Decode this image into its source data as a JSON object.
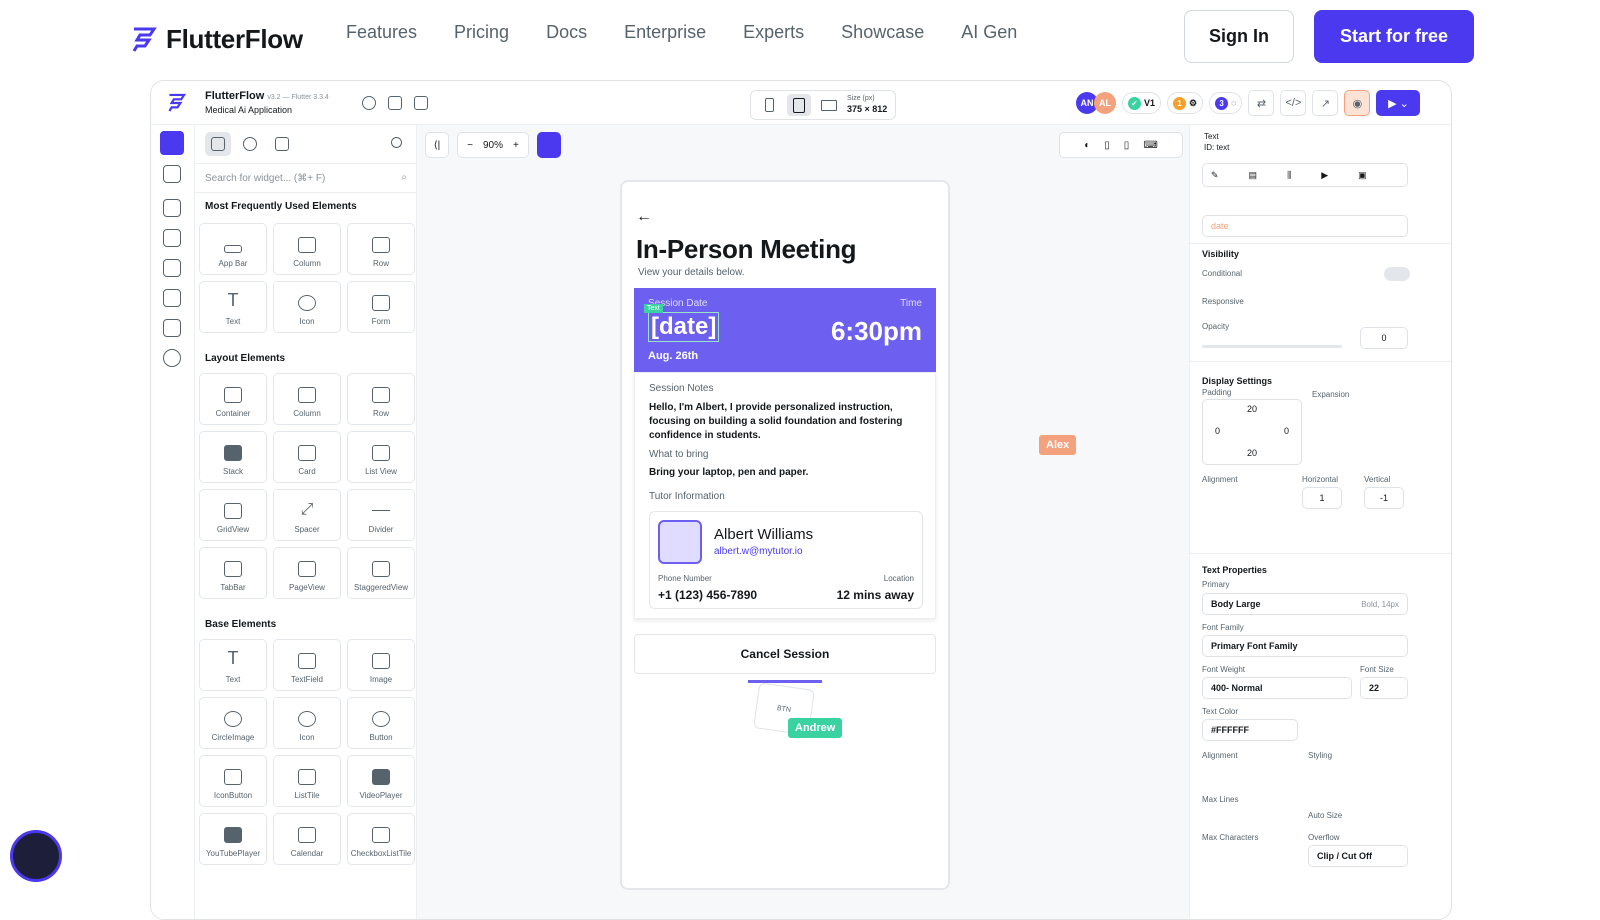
{
  "site": {
    "brand": "FlutterFlow",
    "nav": [
      "Features",
      "Pricing",
      "Docs",
      "Enterprise",
      "Experts",
      "Showcase",
      "AI Gen"
    ],
    "sign_in": "Sign In",
    "start": "Start for free"
  },
  "editor": {
    "project_name": "FlutterFlow",
    "version": "v3.2 — Flutter 3.3.4",
    "app_name": "Medical Ai Application",
    "size_label": "Size (px)",
    "size_value": "375 × 812",
    "avatars": [
      "AN",
      "AL"
    ],
    "version_tag": "V1",
    "count1": "1",
    "count2": "3"
  },
  "widgets": {
    "search_placeholder": "Search for widget... (⌘+ F)",
    "sections": [
      {
        "title": "Most Frequently Used Elements",
        "items": [
          "App Bar",
          "Column",
          "Row",
          "Text",
          "Icon",
          "Form"
        ]
      },
      {
        "title": "Layout Elements",
        "items": [
          "Container",
          "Column",
          "Row",
          "Stack",
          "Card",
          "List View",
          "GridView",
          "Spacer",
          "Divider",
          "TabBar",
          "PageView",
          "StaggeredView"
        ]
      },
      {
        "title": "Base Elements",
        "items": [
          "Text",
          "TextField",
          "Image",
          "CircleImage",
          "Icon",
          "Button",
          "IconButton",
          "ListTile",
          "VideoPlayer",
          "YouTubePlayer",
          "Calendar",
          "CheckboxListTile"
        ]
      }
    ]
  },
  "canvas": {
    "zoom": "90%",
    "title": "In-Person Meeting",
    "subtitle": "View your details below.",
    "session_date_label": "Session Date",
    "time_label": "Time",
    "text_tag": "Text",
    "date_value": "[date]",
    "time_value": "6:30pm",
    "date_sub": "Aug. 26th",
    "notes_label": "Session Notes",
    "notes": "Hello, I'm Albert, I provide personalized instruction, focusing on building a solid foundation and fostering confidence in students.",
    "bring_label": "What to bring",
    "bring": "Bring your laptop, pen and paper.",
    "tutor_label": "Tutor Information",
    "tutor_name": "Albert Williams",
    "tutor_email": "albert.w@mytutor.io",
    "phone_label": "Phone Number",
    "phone": "+1 (123) 456-7890",
    "location_label": "Location",
    "location": "12 mins away",
    "cancel": "Cancel Session",
    "cursor_alex": "Alex",
    "cursor_andrew": "Andrew",
    "drag_btn": "BTN"
  },
  "props": {
    "widget_type": "Text",
    "widget_id": "ID: text",
    "bound_value": "date",
    "visibility": "Visibility",
    "conditional": "Conditional",
    "responsive": "Responsive",
    "opacity": "Opacity",
    "opacity_value": "0",
    "display_settings": "Display Settings",
    "padding": "Padding",
    "expansion": "Expansion",
    "pad_top": "20",
    "pad_left": "0",
    "pad_right": "0",
    "pad_bottom": "20",
    "alignment": "Alignment",
    "horizontal": "Horizontal",
    "vertical": "Vertical",
    "h_value": "1",
    "v_value": "-1",
    "text_properties": "Text Properties",
    "primary": "Primary",
    "theme_style": "Body Large",
    "theme_meta": "Bold, 14px",
    "font_family_label": "Font Family",
    "font_family": "Primary Font Family",
    "font_weight_label": "Font Weight",
    "font_weight": "400- Normal",
    "font_size_label": "Font Size",
    "font_size": "22",
    "text_color_label": "Text Color",
    "text_color": "#FFFFFF",
    "alignment2": "Alignment",
    "styling": "Styling",
    "max_lines": "Max Lines",
    "auto_size": "Auto Size",
    "max_chars": "Max Characters",
    "overflow": "Overflow",
    "overflow_value": "Clip / Cut Off"
  },
  "colors": {
    "primary": "#4b39ef",
    "hero": "#6d5ff0",
    "cursor": "#f4a27e",
    "andrew": "#39d2a0"
  }
}
